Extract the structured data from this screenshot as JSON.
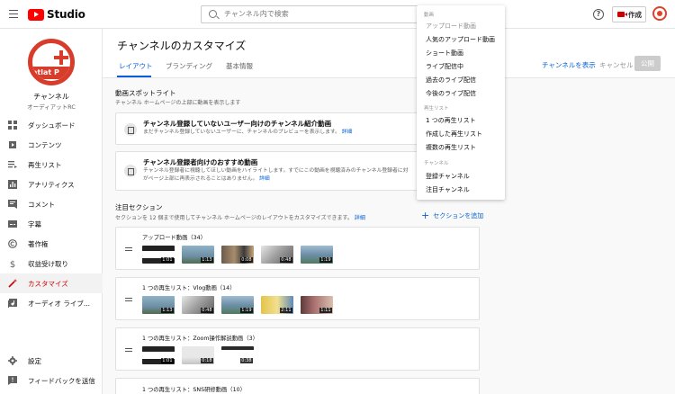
{
  "topbar": {
    "logo_text": "Studio",
    "search_placeholder": "チャンネル内で検索",
    "help_glyph": "?",
    "create_label": "作成"
  },
  "sidebar": {
    "avatar_band_text": "atlat P",
    "channel_name": "チャンネル",
    "channel_sub": "オーディアットRC",
    "items": [
      {
        "label": "ダッシュボード",
        "icon": "dashboard-icon"
      },
      {
        "label": "コンテンツ",
        "icon": "content-icon"
      },
      {
        "label": "再生リスト",
        "icon": "playlist-icon"
      },
      {
        "label": "アナリティクス",
        "icon": "analytics-icon"
      },
      {
        "label": "コメント",
        "icon": "comment-icon"
      },
      {
        "label": "字幕",
        "icon": "subtitle-icon"
      },
      {
        "label": "著作権",
        "icon": "copyright-icon"
      },
      {
        "label": "収益受け取り",
        "icon": "dollar-icon"
      },
      {
        "label": "カスタマイズ",
        "icon": "magic-wand-icon",
        "active": true
      },
      {
        "label": "オーディオ ライブ...",
        "icon": "audio-library-icon"
      }
    ],
    "bottom_items": [
      {
        "label": "設定",
        "icon": "gear-icon"
      },
      {
        "label": "フィードバックを送信",
        "icon": "feedback-icon"
      }
    ]
  },
  "header": {
    "title": "チャンネルのカスタマイズ",
    "tabs": [
      "レイアウト",
      "ブランディング",
      "基本情報"
    ],
    "view_channel": "チャンネルを表示",
    "cancel": "キャンセル",
    "publish": "公開"
  },
  "spotlight": {
    "title": "動画スポットライト",
    "desc": "チャンネル ホームページの上部に動画を表示します",
    "cards": [
      {
        "title": "チャンネル登録していないユーザー向けのチャンネル紹介動画",
        "desc": "まだチャンネル登録していないユーザーに、チャンネルのプレビューを表示します。",
        "link": "詳細"
      },
      {
        "title": "チャンネル登録者向けのおすすめ動画",
        "desc": "チャンネル登録者に視聴してほしい動画をハイライトします。すでにこの動画を視聴済みのチャンネル登録者に対",
        "desc2": "がページ上部に再表示されることはありません。",
        "link": "詳細"
      }
    ]
  },
  "featured": {
    "title": "注目セクション",
    "desc": "セクションを 12 個まで使用してチャンネル ホームページのレイアウトをカスタマイズできます。",
    "link": "詳細",
    "add_section": "セクションを追加",
    "sections": [
      {
        "label": "アップロード動画（34）",
        "durations": [
          "1:01",
          "1:13",
          "0:08",
          "0:48",
          "1:19"
        ]
      },
      {
        "label": "1 つの再生リスト：Vlog動画（14）",
        "durations": [
          "1:13",
          "0:48",
          "1:19",
          "2:11",
          "1:11"
        ]
      },
      {
        "label": "1 つの再生リスト：Zoom操作解説動画（3）",
        "durations": [
          "1:01",
          "0:18",
          "0:38"
        ]
      },
      {
        "label": "1 つの再生リスト：SNS研修動画（10）",
        "durations": []
      }
    ]
  },
  "dropdown": {
    "groups": [
      {
        "heading": "動画",
        "items": [
          "アップロード動画",
          "人気のアップロード動画",
          "ショート動画",
          "ライブ配信中",
          "過去のライブ配信",
          "今後のライブ配信"
        ]
      },
      {
        "heading": "再生リスト",
        "items": [
          "1 つの再生リスト",
          "作成した再生リスト",
          "複数の再生リスト"
        ]
      },
      {
        "heading": "チャンネル",
        "items": [
          "登録チャンネル",
          "注目チャンネル"
        ]
      }
    ]
  },
  "colors": {
    "brand_red": "#ff0000",
    "accent_blue": "#065fd4",
    "active_red": "#cc0000"
  }
}
